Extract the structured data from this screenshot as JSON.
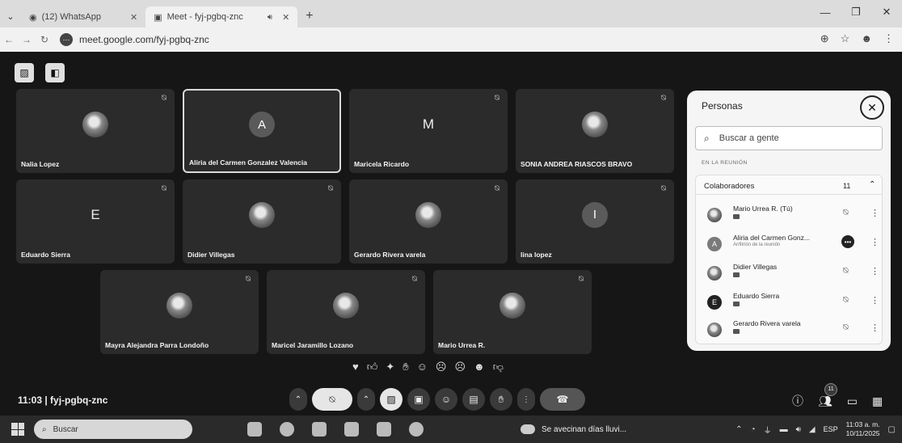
{
  "browser": {
    "tabs": [
      {
        "title": "(12) WhatsApp",
        "active": false
      },
      {
        "title": "Meet - fyj-pgbq-znc",
        "active": true
      }
    ],
    "url": "meet.google.com/fyj-pgbq-znc"
  },
  "tiles": [
    {
      "name": "Nalia Lopez",
      "avatar": "photo"
    },
    {
      "name": "Aliria del Carmen Gonzalez Valencia",
      "avatar": "letter",
      "letter": "A",
      "speaking": true
    },
    {
      "name": "Maricela Ricardo",
      "avatar": "plain",
      "letter": "M"
    },
    {
      "name": "SONIA ANDREA RIASCOS BRAVO",
      "avatar": "photo"
    },
    {
      "name": "Eduardo Sierra",
      "avatar": "plain",
      "letter": "E"
    },
    {
      "name": "Didier Villegas",
      "avatar": "photo"
    },
    {
      "name": "Gerardo Rivera varela",
      "avatar": "photo"
    },
    {
      "name": "lina lopez",
      "avatar": "letter",
      "letter": "I"
    },
    {
      "name": "Mayra Alejandra Parra Londoño",
      "avatar": "photo"
    },
    {
      "name": "Maricel Jaramillo Lozano",
      "avatar": "photo"
    },
    {
      "name": "Mario Urrea R.",
      "avatar": "photo"
    }
  ],
  "panel": {
    "title": "Personas",
    "search_placeholder": "Buscar a gente",
    "section_label": "EN LA REUNIÓN",
    "group_title": "Colaboradores",
    "group_count": "11",
    "people": [
      {
        "name": "Mario Urrea R. (Tú)",
        "sub": "",
        "avatar": "photo",
        "letter": ""
      },
      {
        "name": "Aliria del Carmen Gonz...",
        "sub": "Anfitrión de la reunión",
        "avatar": "letter",
        "letter": "A"
      },
      {
        "name": "Didier Villegas",
        "sub": "",
        "avatar": "photo",
        "letter": ""
      },
      {
        "name": "Eduardo Sierra",
        "sub": "",
        "avatar": "dark",
        "letter": "E"
      },
      {
        "name": "Gerardo Rivera varela",
        "sub": "",
        "avatar": "photo",
        "letter": ""
      }
    ]
  },
  "meeting": {
    "code_label": "11:03 | fyj-pgbq-znc",
    "participants_badge": "11"
  },
  "taskbar": {
    "search_placeholder": "Buscar",
    "news": "Se avecinan días lluvi...",
    "lang": "ESP",
    "time": "11:03 a. m.",
    "date": "10/11/2025"
  },
  "colors": {
    "stage_bg": "#161616",
    "tile_bg": "#2b2b2b",
    "panel_bg": "#f5f5f5"
  }
}
